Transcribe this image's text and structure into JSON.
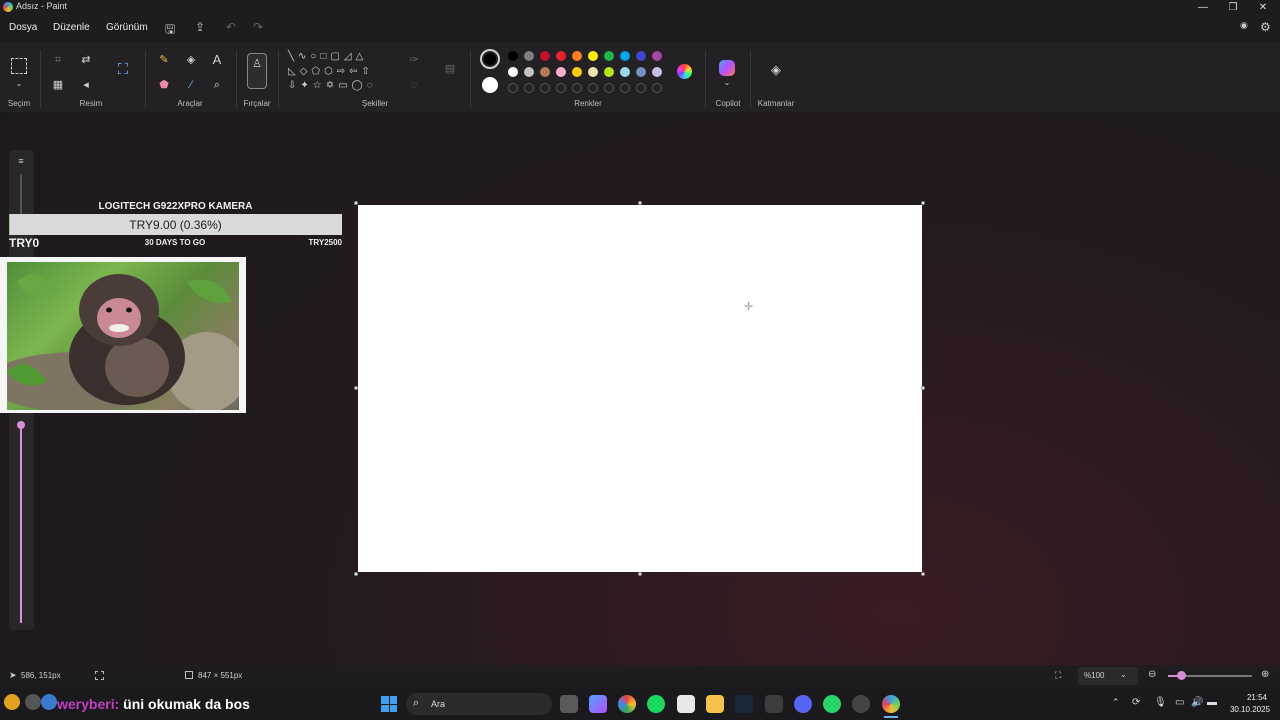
{
  "window": {
    "title": "Adsız - Paint"
  },
  "menu": {
    "items": [
      "Dosya",
      "Düzenle",
      "Görünüm"
    ]
  },
  "ribbon": {
    "groups": [
      "Seçim",
      "Resim",
      "Araçlar",
      "Fırçalar",
      "Şekiller",
      "Renkler",
      "Copilot",
      "Katmanlar"
    ],
    "colors_row1": [
      "#000000",
      "#7f7f7f",
      "#c3102f",
      "#e8212d",
      "#ff7f27",
      "#fff200",
      "#22b14c",
      "#00a2e8",
      "#3f48cc",
      "#a349a4"
    ],
    "colors_row2": [
      "#ffffff",
      "#c3c3c3",
      "#b97a57",
      "#ffaec9",
      "#ffc90e",
      "#efe4b0",
      "#b5e61d",
      "#99d9ea",
      "#7092be",
      "#c8bfe7"
    ],
    "primary_color": "#000000",
    "secondary_color": "#ffffff"
  },
  "overlay": {
    "goal_title": "LOGITECH G922XPRO KAMERA",
    "goal_value": "TRY9.00 (0.36%)",
    "goal_start": "TRY0",
    "goal_days": "30 DAYS TO GO",
    "goal_end": "TRY2500",
    "progress_percent": 0.36
  },
  "status": {
    "cursor_pos": "586, 151px",
    "canvas_size": "847 × 551px",
    "zoom": "%100"
  },
  "taskbar": {
    "chat_user": "weryberi:",
    "chat_message": "üni okumak da bos",
    "search_placeholder": "Ara",
    "time": "21:54",
    "date": "30.10.2025"
  }
}
